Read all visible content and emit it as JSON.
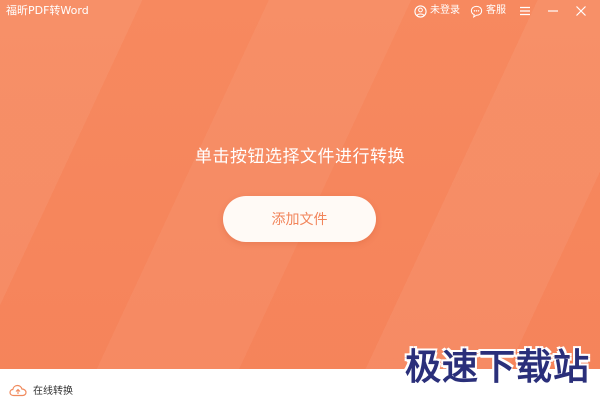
{
  "window": {
    "title": "福昕PDF转Word",
    "login_label": "未登录",
    "service_label": "客服"
  },
  "main": {
    "prompt": "单击按钮选择文件进行转换",
    "add_file_label": "添加文件"
  },
  "footer": {
    "online_convert_label": "在线转换"
  },
  "watermark": {
    "text": "极速下载站"
  },
  "colors": {
    "accent": "#f6865c",
    "button_text": "#f2845a",
    "footer_bg": "#ffffff"
  },
  "icons": {
    "login": "user-circle-icon",
    "service": "chat-bubble-icon",
    "menu": "menu-icon",
    "minimize": "minimize-icon",
    "close": "close-icon",
    "online_convert": "cloud-icon"
  }
}
